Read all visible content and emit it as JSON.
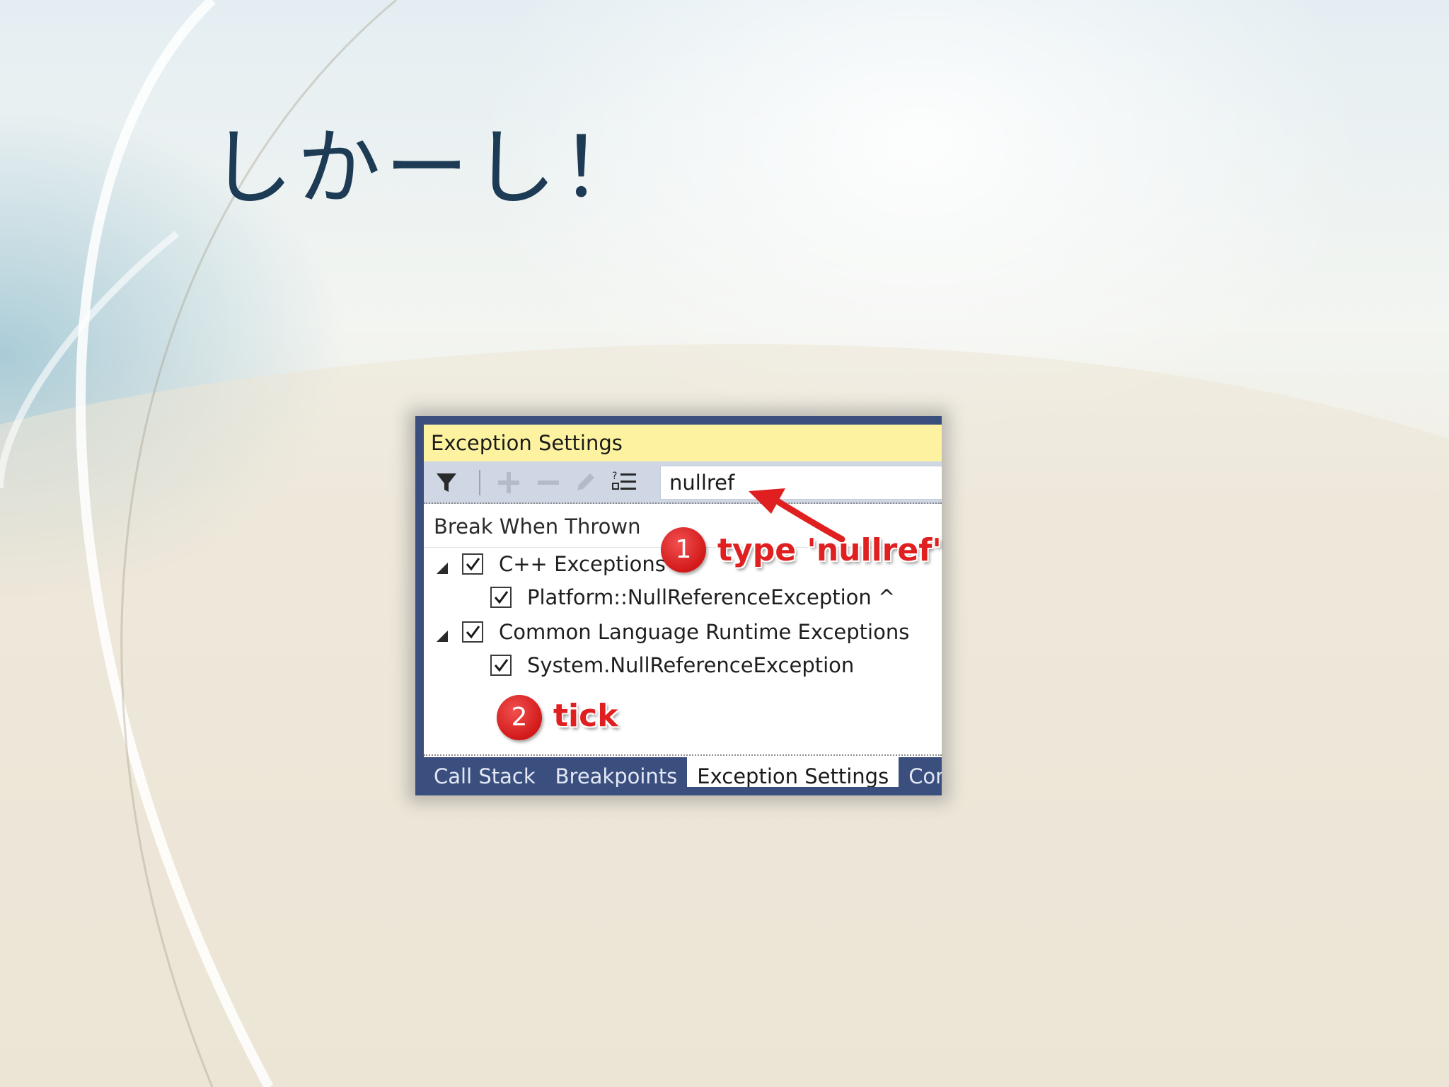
{
  "slide": {
    "title": "しかーし！"
  },
  "panel": {
    "title": "Exception Settings",
    "toolbar": {
      "icons": [
        "filter-icon",
        "add-icon",
        "remove-icon",
        "edit-icon",
        "list-icon"
      ],
      "search_value": "nullref"
    },
    "column_header": "Break When Thrown",
    "tree": [
      {
        "label": "C++ Exceptions",
        "checked": true,
        "level": 0,
        "expanded": true
      },
      {
        "label": "Platform::NullReferenceException ^",
        "checked": true,
        "level": 1
      },
      {
        "label": "Common Language Runtime Exceptions",
        "checked": true,
        "level": 0,
        "expanded": true
      },
      {
        "label": "System.NullReferenceException",
        "checked": true,
        "level": 1
      }
    ],
    "tabs": [
      {
        "label": "Call Stack",
        "active": false
      },
      {
        "label": "Breakpoints",
        "active": false
      },
      {
        "label": "Exception Settings",
        "active": true
      },
      {
        "label": "Com",
        "active": false
      }
    ]
  },
  "annotations": [
    {
      "number": "1",
      "text": "type 'nullref'"
    },
    {
      "number": "2",
      "text": "tick"
    }
  ],
  "colors": {
    "title_text": "#1d3b55",
    "panel_frame": "#3b4f7e",
    "title_bar": "#fdf29f",
    "toolbar": "#cfd6e4",
    "annotation_red": "#e02020"
  }
}
